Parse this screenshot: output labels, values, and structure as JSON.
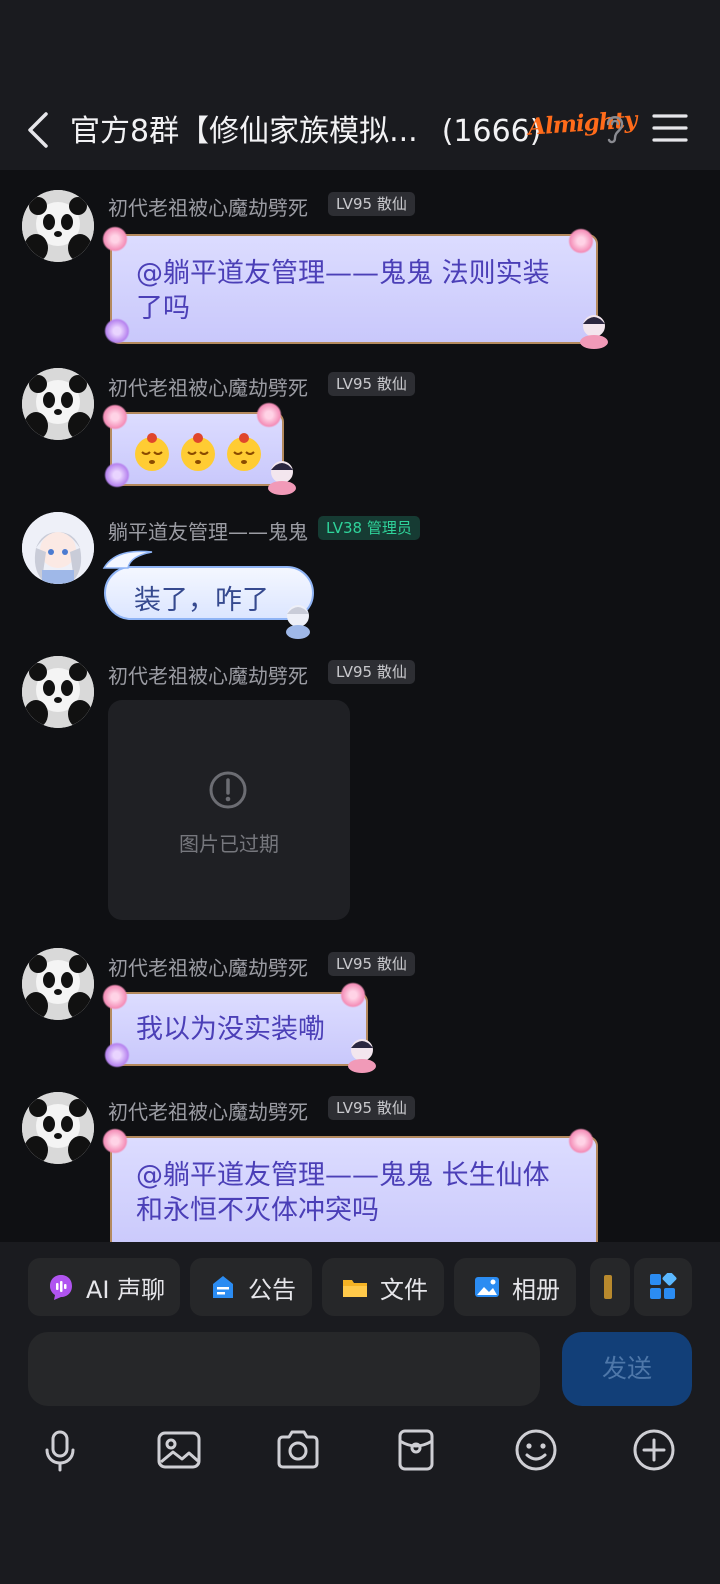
{
  "header": {
    "title": "官方8群【修仙家族模拟...",
    "member_count": "(1666)",
    "brand_mark": "Almighty"
  },
  "messages": [
    {
      "sender": "初代老祖被心魔劫劈死",
      "level": "LV95 散仙",
      "text": "@躺平道友管理——鬼鬼 法则实装了吗"
    },
    {
      "sender": "初代老祖被心魔劫劈死",
      "level": "LV95 散仙",
      "text": ""
    },
    {
      "sender": "躺平道友管理——鬼鬼",
      "level": "LV38 管理员",
      "text": "装了，咋了"
    },
    {
      "sender": "初代老祖被心魔劫劈死",
      "level": "LV95 散仙",
      "image_status": "图片已过期"
    },
    {
      "sender": "初代老祖被心魔劫劈死",
      "level": "LV95 散仙",
      "text": "我以为没实装嘞"
    },
    {
      "sender": "初代老祖被心魔劫劈死",
      "level": "LV95 散仙",
      "text": "@躺平道友管理——鬼鬼 长生仙体和永恒不灭体冲突吗"
    }
  ],
  "quick_actions": [
    {
      "label": "AI 声聊",
      "icon": "ai-voice-icon"
    },
    {
      "label": "公告",
      "icon": "announcement-icon"
    },
    {
      "label": "文件",
      "icon": "folder-icon"
    },
    {
      "label": "相册",
      "icon": "album-icon"
    }
  ],
  "composer": {
    "send_label": "发送"
  },
  "bottom_tools": [
    "microphone-icon",
    "image-icon",
    "camera-icon",
    "red-packet-icon",
    "emoji-icon",
    "plus-icon"
  ],
  "colors": {
    "background": "#0f1013",
    "bar": "#1a1b1f",
    "bubble": "#d4d3fd",
    "bubble_text": "#4b3fb7",
    "send_button": "#123f78",
    "admin_badge": "#2fd39a"
  }
}
